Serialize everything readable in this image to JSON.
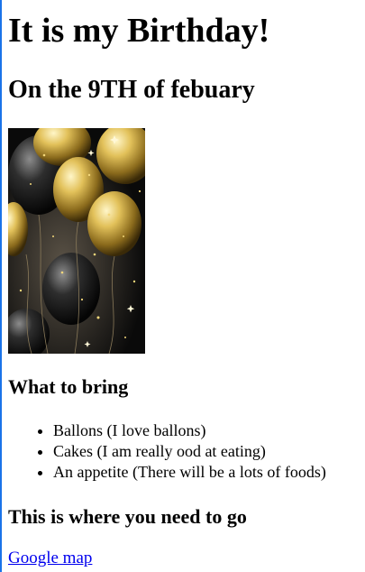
{
  "page": {
    "title": "It is my Birthday!",
    "subtitle": "On the 9TH of febuary",
    "image_alt": "gold and black balloons",
    "bring_heading": "What to bring",
    "bring_items": [
      "Ballons (I love ballons)",
      "Cakes (I am really ood at eating)",
      "An appetite (There will be a lots of foods)"
    ],
    "location_heading": "This is where you need to go",
    "map_link_text": "Google map"
  },
  "colors": {
    "link": "#0000ee",
    "left_bar": "#1a73e8",
    "gold": "#d4af37",
    "dark": "#111111"
  }
}
